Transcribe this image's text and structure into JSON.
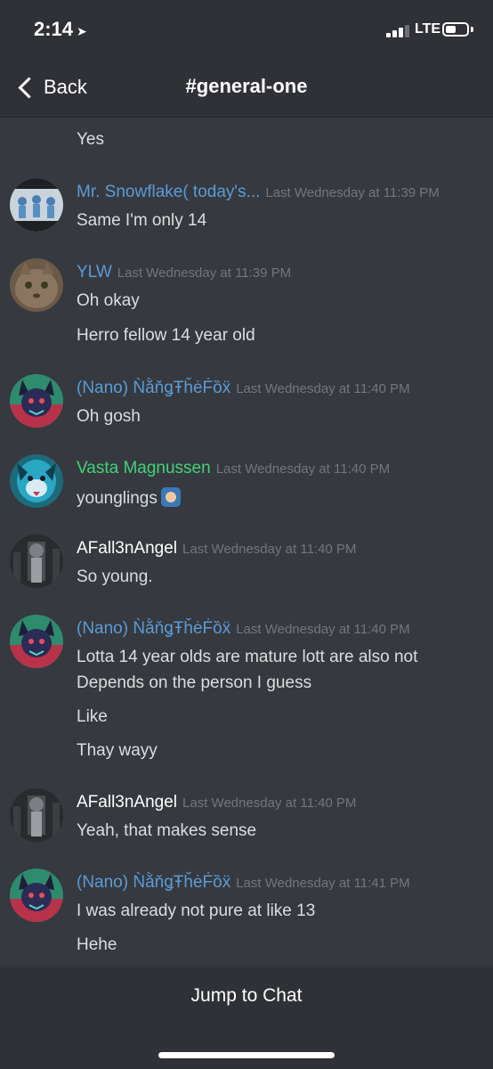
{
  "status_bar": {
    "time": "2:14",
    "location_arrow": "➤",
    "network": "LTE"
  },
  "nav": {
    "back_label": "Back",
    "title": "#general-one"
  },
  "messages": [
    {
      "continuation": "Yes"
    },
    {
      "author": "Mr. Snowflake( today's...",
      "author_color": "#5b9bd5",
      "timestamp": "Last Wednesday at 11:39 PM",
      "lines": [
        "Same I'm only 14"
      ]
    },
    {
      "author": "YLW",
      "author_color": "#5b9bd5",
      "timestamp": "Last Wednesday at 11:39 PM",
      "lines": [
        "Oh okay",
        "Herro fellow 14 year old"
      ]
    },
    {
      "author": "(Nano) ǸằňǥŦȟėḞȍẍ",
      "author_color": "#5b9bd5",
      "timestamp": "Last Wednesday at 11:40 PM",
      "lines": [
        "Oh gosh"
      ]
    },
    {
      "author": "Vasta Magnussen",
      "author_color": "#43d17a",
      "timestamp": "Last Wednesday at 11:40 PM",
      "lines": [
        "younglings"
      ],
      "emoji": "person-emoji"
    },
    {
      "author": "AFall3nAngel",
      "author_color": "#ffffff",
      "timestamp": "Last Wednesday at 11:40 PM",
      "lines": [
        "So young."
      ]
    },
    {
      "author": "(Nano) ǸằňǥŦȟėḞȍẍ",
      "author_color": "#5b9bd5",
      "timestamp": "Last Wednesday at 11:40 PM",
      "lines": [
        "Lotta 14 year olds are mature lott are also not",
        "Depends on the person I guess",
        "Like",
        "Thay wayy"
      ]
    },
    {
      "author": "AFall3nAngel",
      "author_color": "#ffffff",
      "timestamp": "Last Wednesday at 11:40 PM",
      "lines": [
        "Yeah, that makes sense"
      ]
    },
    {
      "author": "(Nano) ǸằňǥŦȟėḞȍẍ",
      "author_color": "#5b9bd5",
      "timestamp": "Last Wednesday at 11:41 PM",
      "lines": [
        "I was already not pure at like 13",
        "Hehe"
      ]
    }
  ],
  "footer": {
    "jump_label": "Jump to Chat"
  },
  "colors": {
    "background": "#36393f",
    "bar": "#2f3136",
    "timestamp": "#72767d",
    "text": "#dcddde"
  }
}
